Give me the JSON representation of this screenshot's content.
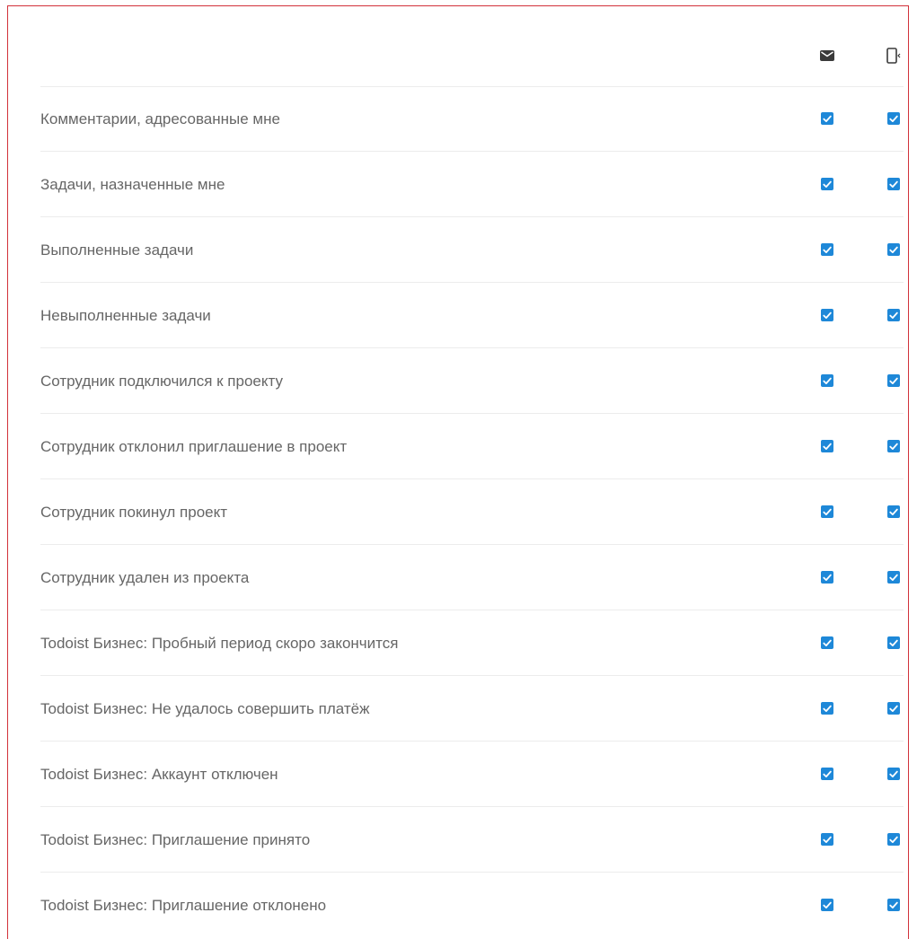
{
  "columns": [
    {
      "icon": "mail-icon"
    },
    {
      "icon": "mobile-push-icon"
    }
  ],
  "accent_color": "#1e88d8",
  "rows": [
    {
      "label": "Комментарии, адресованные мне",
      "email": true,
      "push": true
    },
    {
      "label": "Задачи, назначенные мне",
      "email": true,
      "push": true
    },
    {
      "label": "Выполненные задачи",
      "email": true,
      "push": true
    },
    {
      "label": "Невыполненные задачи",
      "email": true,
      "push": true
    },
    {
      "label": "Сотрудник подключился к проекту",
      "email": true,
      "push": true
    },
    {
      "label": "Сотрудник отклонил приглашение в проект",
      "email": true,
      "push": true
    },
    {
      "label": "Сотрудник покинул проект",
      "email": true,
      "push": true
    },
    {
      "label": "Сотрудник удален из проекта",
      "email": true,
      "push": true
    },
    {
      "label": "Todoist Бизнес: Пробный период скоро закончится",
      "email": true,
      "push": true
    },
    {
      "label": "Todoist Бизнес: Не удалось совершить платёж",
      "email": true,
      "push": true
    },
    {
      "label": "Todoist Бизнес: Аккаунт отключен",
      "email": true,
      "push": true
    },
    {
      "label": "Todoist Бизнес: Приглашение принято",
      "email": true,
      "push": true
    },
    {
      "label": "Todoist Бизнес: Приглашение отклонено",
      "email": true,
      "push": true
    }
  ]
}
